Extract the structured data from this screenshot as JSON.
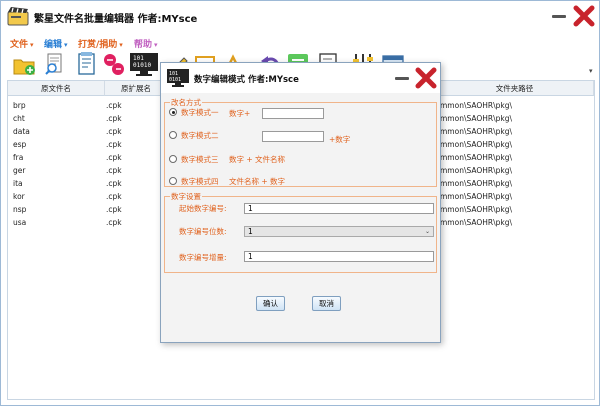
{
  "app": {
    "title": "繁星文件名批量编辑器 作者:MYsce"
  },
  "menu": [
    {
      "label": "文件",
      "color": "#e0621e"
    },
    {
      "label": "编辑",
      "color": "#2a7fd4"
    },
    {
      "label": "打赏/捐助",
      "color": "#e0621e"
    },
    {
      "label": "帮助",
      "color": "#c060c0"
    }
  ],
  "toolbar_icons": [
    "folder-add-icon",
    "search-file-icon",
    "document-list-icon",
    "swap-icon",
    "binary-monitor-icon",
    "edit-icon",
    "rename-icon",
    "text-icon",
    "undo-icon",
    "list-icon",
    "doc-edit-icon",
    "equalizer-icon",
    "window-icon"
  ],
  "grid": {
    "headers": [
      "原文件名",
      "原扩展名",
      "文件夹路径"
    ],
    "rows": [
      {
        "name": "brp",
        "ext": ".cpk",
        "path": "mmon\\SAOHR\\pkg\\"
      },
      {
        "name": "cht",
        "ext": ".cpk",
        "path": "mmon\\SAOHR\\pkg\\"
      },
      {
        "name": "data",
        "ext": ".cpk",
        "path": "mmon\\SAOHR\\pkg\\"
      },
      {
        "name": "esp",
        "ext": ".cpk",
        "path": "mmon\\SAOHR\\pkg\\"
      },
      {
        "name": "fra",
        "ext": ".cpk",
        "path": "mmon\\SAOHR\\pkg\\"
      },
      {
        "name": "ger",
        "ext": ".cpk",
        "path": "mmon\\SAOHR\\pkg\\"
      },
      {
        "name": "ita",
        "ext": ".cpk",
        "path": "mmon\\SAOHR\\pkg\\"
      },
      {
        "name": "kor",
        "ext": ".cpk",
        "path": "mmon\\SAOHR\\pkg\\"
      },
      {
        "name": "nsp",
        "ext": ".cpk",
        "path": "mmon\\SAOHR\\pkg\\"
      },
      {
        "name": "usa",
        "ext": ".cpk",
        "path": "mmon\\SAOHR\\pkg\\"
      }
    ]
  },
  "dialog": {
    "title": "数字编辑模式 作者:MYsce",
    "naming_group": "改名方式",
    "modes": [
      {
        "label": "数字模式一",
        "desc": "数字+",
        "selected": true
      },
      {
        "label": "数字模式二",
        "desc": "+数字",
        "selected": false
      },
      {
        "label": "数字模式三",
        "desc": "数字 + 文件名称",
        "selected": false
      },
      {
        "label": "数字模式四",
        "desc": "文件名称 + 数字",
        "selected": false
      }
    ],
    "mode1_value": "",
    "mode2_value": "",
    "settings_group": "数字设置",
    "start_label": "起始数字编号:",
    "start_value": "1",
    "digits_label": "数字编号位数:",
    "digits_value": "1",
    "increment_label": "数字编号增量:",
    "increment_value": "1",
    "ok": "确认",
    "cancel": "取消"
  },
  "colors": {
    "accent_orange": "#e0621e",
    "accent_blue": "#2a7fd4",
    "close_red": "#c8232c"
  }
}
